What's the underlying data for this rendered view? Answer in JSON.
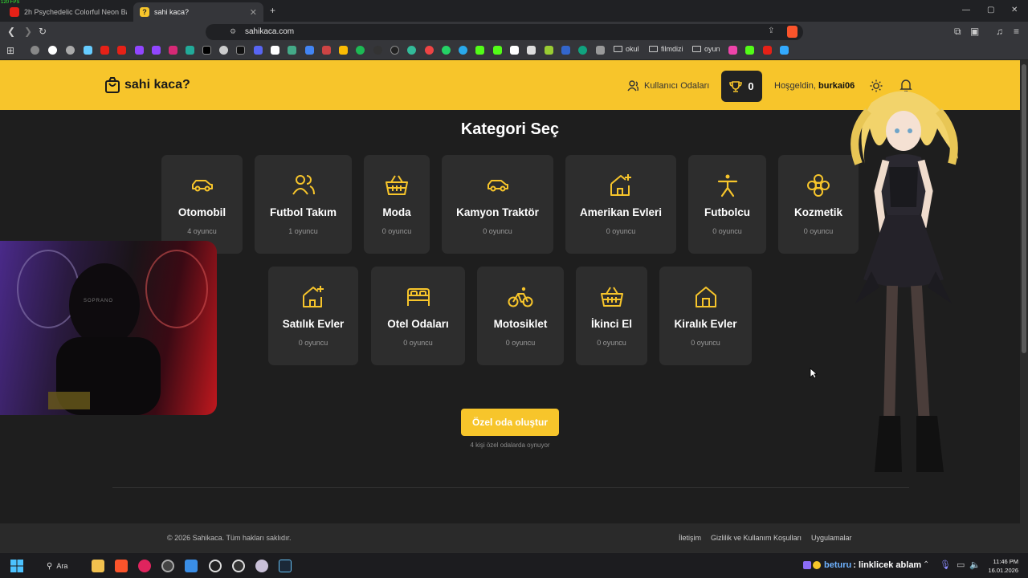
{
  "browser": {
    "fps": "120 FPS",
    "tabs": [
      {
        "title": "2h Psychedelic Colorful Neon Backgr",
        "active": false
      },
      {
        "title": "sahi kaca?",
        "active": true
      }
    ],
    "url": "sahikaca.com",
    "bookmark_folders": [
      "okul",
      "filmdizi",
      "oyun"
    ]
  },
  "site": {
    "logo": "sahi kaca?",
    "nav_rooms": "Kullanıcı Odaları",
    "trophy_count": "0",
    "welcome": "Hoşgeldin,",
    "username": "burkai06"
  },
  "main": {
    "title": "Kategori Seç",
    "row1": [
      {
        "name": "Otomobil",
        "count": "4 oyuncu",
        "icon": "car-icon"
      },
      {
        "name": "Futbol Takım",
        "count": "1 oyuncu",
        "icon": "users-icon"
      },
      {
        "name": "Moda",
        "count": "0 oyuncu",
        "icon": "basket-icon"
      },
      {
        "name": "Kamyon Traktör",
        "count": "0 oyuncu",
        "icon": "car-icon"
      },
      {
        "name": "Amerikan Evleri",
        "count": "0 oyuncu",
        "icon": "house-plus-icon"
      },
      {
        "name": "Futbolcu",
        "count": "0 oyuncu",
        "icon": "person-icon"
      },
      {
        "name": "Kozmetik",
        "count": "0 oyuncu",
        "icon": "flower-icon"
      }
    ],
    "row2": [
      {
        "name": "Satılık Evler",
        "count": "0 oyuncu",
        "icon": "house-plus-icon"
      },
      {
        "name": "Otel Odaları",
        "count": "0 oyuncu",
        "icon": "bed-icon"
      },
      {
        "name": "Motosiklet",
        "count": "0 oyuncu",
        "icon": "bike-icon"
      },
      {
        "name": "İkinci El",
        "count": "0 oyuncu",
        "icon": "basket-icon"
      },
      {
        "name": "Kiralık Evler",
        "count": "0 oyuncu",
        "icon": "house-icon"
      }
    ],
    "create_button": "Özel oda oluştur",
    "private_note": "4 kişi özel odalarda oynuyor"
  },
  "footer": {
    "copyright": "© 2026 Sahikaca. Tüm hakları saklıdır.",
    "links": [
      "İletişim",
      "Gizlilik ve Kullanım Koşulları",
      "Uygulamalar"
    ]
  },
  "overlay": {
    "webcam_text": "SOPRANO"
  },
  "taskbar": {
    "search": "Ara",
    "chat_user": "beturu",
    "chat_message": ": linklicek ablam",
    "time": "11:46 PM",
    "date": "16.01.2026"
  },
  "colors": {
    "accent": "#f7c52b",
    "card": "#2d2d2d",
    "page_bg": "#1e1e1e"
  }
}
